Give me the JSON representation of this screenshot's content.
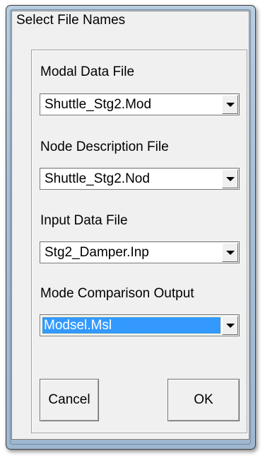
{
  "dialog": {
    "title": "Select File Names"
  },
  "fields": [
    {
      "label": "Modal Data File",
      "value": "Shuttle_Stg2.Mod",
      "selected": false
    },
    {
      "label": "Node Description File",
      "value": "Shuttle_Stg2.Nod",
      "selected": false
    },
    {
      "label": "Input Data File",
      "value": "Stg2_Damper.Inp",
      "selected": false
    },
    {
      "label": "Mode Comparison Output",
      "value": "Modsel.Msl",
      "selected": true
    }
  ],
  "buttons": {
    "cancel_label": "Cancel",
    "ok_label": "OK"
  },
  "colors": {
    "selection_highlight": "#3399ff",
    "frame_blue": "#b9cde1"
  }
}
